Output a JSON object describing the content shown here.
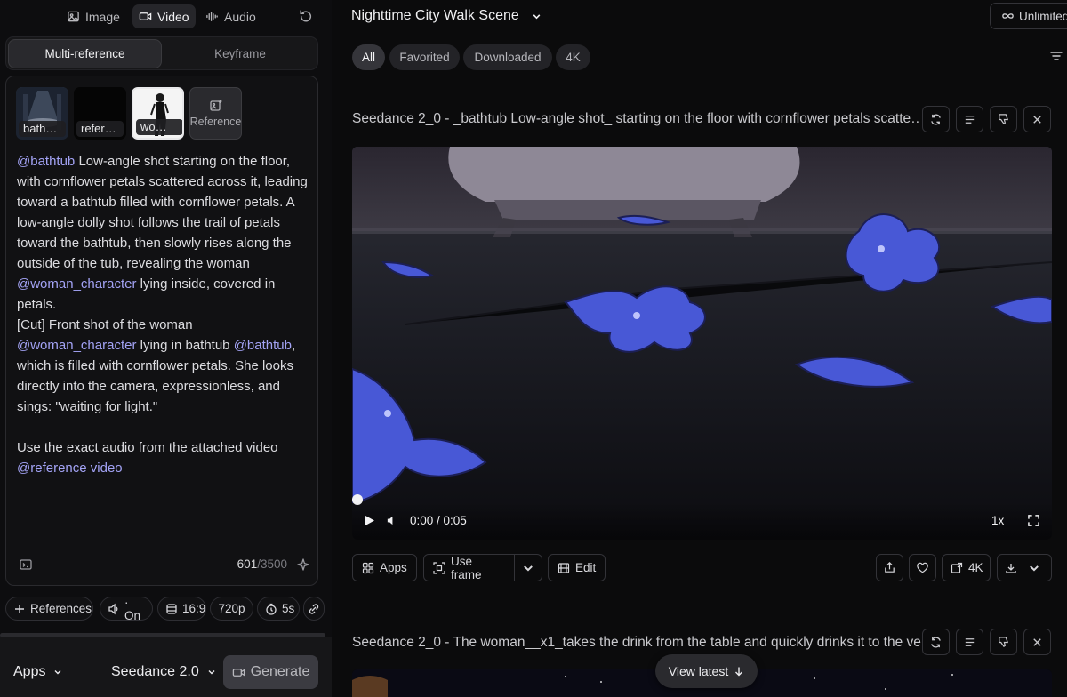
{
  "nav": {
    "items": [
      {
        "label": "Image",
        "icon": "image-icon",
        "active": false
      },
      {
        "label": "Video",
        "icon": "video-icon",
        "active": true
      },
      {
        "label": "Audio",
        "icon": "audio-icon",
        "active": false
      }
    ]
  },
  "mode_tabs": {
    "multi": "Multi-reference",
    "keyframe": "Keyframe"
  },
  "references": [
    {
      "label": "bath…"
    },
    {
      "label": "refer…"
    },
    {
      "label": "wo…"
    }
  ],
  "reference_add_label": "Reference",
  "prompt": {
    "segments": [
      {
        "text": "@bathtub",
        "mention": true
      },
      {
        "text": " Low-angle shot starting on the floor, with cornflower petals scattered across it, leading toward a bathtub filled with cornflower petals. A low-angle dolly shot follows the trail of petals toward the bathtub, then slowly rises along the outside of the tub, revealing the woman ",
        "mention": false
      },
      {
        "text": "@woman_character",
        "mention": true
      },
      {
        "text": " lying inside, covered in petals.\n[Cut] Front shot of the woman\n",
        "mention": false
      },
      {
        "text": "@woman_character",
        "mention": true
      },
      {
        "text": " lying in bathtub ",
        "mention": false
      },
      {
        "text": "@bathtub",
        "mention": true
      },
      {
        "text": ", which is filled with cornflower petals. She looks directly into the camera, expressionless, and sings: \"waiting for light.\"\n\nUse the exact audio from the attached video\n",
        "mention": false
      },
      {
        "text": "@reference video",
        "mention": true
      }
    ],
    "char_count": "601",
    "char_max": "/3500"
  },
  "chips": {
    "references": "References",
    "audio": "· On",
    "ratio": "16:9",
    "resolution": "720p",
    "duration": "5s"
  },
  "bottom": {
    "apps": "Apps",
    "model": "Seedance 2.0",
    "generate": "Generate"
  },
  "header": {
    "project_title": "Nighttime City Walk Scene",
    "plan": "Unlimited"
  },
  "filters": [
    "All",
    "Favorited",
    "Downloaded",
    "4K"
  ],
  "active_filter": "All",
  "cards": [
    {
      "title": "Seedance 2_0 - _bathtub Low-angle shot_ starting on the floor with cornflower petals scatte…"
    },
    {
      "title": "Seedance 2_0 - The woman__x1_takes the drink from the table and quickly drinks it to the ve…"
    }
  ],
  "player": {
    "time": "0:00 / 0:05",
    "speed": "1x",
    "progress": 0
  },
  "actions": {
    "apps": "Apps",
    "use_frame": "Use frame",
    "edit": "Edit",
    "quality": "4K"
  },
  "view_latest": "View latest",
  "colors": {
    "accent_mention": "#a3a3f5",
    "background": "#0d0d0f",
    "panel": "#111113",
    "generate_button": "#3b3b41"
  }
}
